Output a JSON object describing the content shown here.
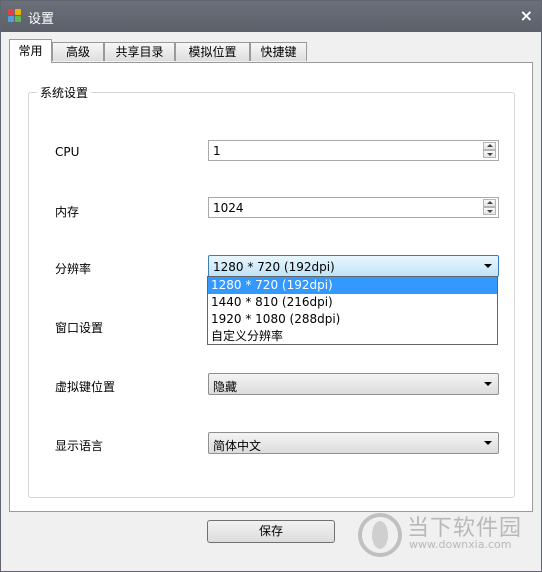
{
  "window": {
    "title": "设置",
    "close_glyph": "×"
  },
  "tabs": [
    {
      "label": "常用",
      "active": true
    },
    {
      "label": "高级"
    },
    {
      "label": "共享目录"
    },
    {
      "label": "模拟位置"
    },
    {
      "label": "快捷键"
    }
  ],
  "group": {
    "title": "系统设置"
  },
  "settings": {
    "cpu": {
      "label": "CPU",
      "value": "1"
    },
    "memory": {
      "label": "内存",
      "value": "1024"
    },
    "resolution": {
      "label": "分辨率",
      "value": "1280 * 720 (192dpi)",
      "options": [
        "1280 * 720 (192dpi)",
        "1440 * 810 (216dpi)",
        "1920 * 1080 (288dpi)",
        "自定义分辨率"
      ]
    },
    "window": {
      "label": "窗口设置"
    },
    "virtual_keys": {
      "label": "虚拟键位置",
      "value": "隐藏"
    },
    "language": {
      "label": "显示语言",
      "value": "简体中文"
    }
  },
  "save_label": "保存",
  "watermark": {
    "text": "当下软件园",
    "url": "www.downxia.com"
  },
  "colors": {
    "titlebar": "#5c6069",
    "selection": "#3399ff"
  }
}
